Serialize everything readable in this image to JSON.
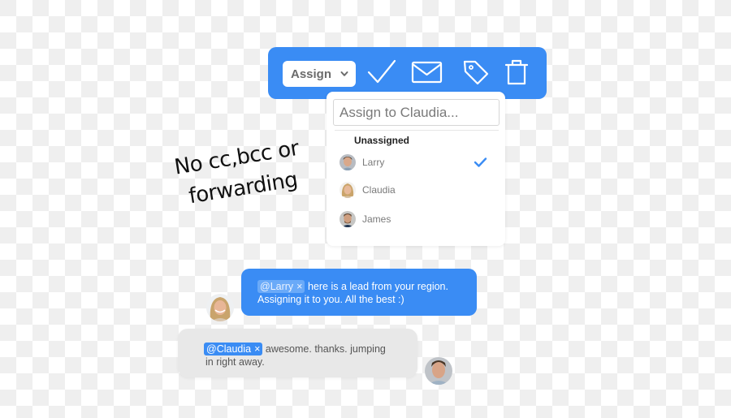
{
  "toolbar": {
    "assign_label": "Assign",
    "icons": [
      "checkmark-icon",
      "envelope-icon",
      "tag-icon",
      "trash-icon"
    ],
    "color": "#3a8cf4"
  },
  "dropdown": {
    "search_placeholder": "Assign to Claudia...",
    "section_label": "Unassigned",
    "items": [
      {
        "name": "Larry",
        "selected": true
      },
      {
        "name": "Claudia",
        "selected": false
      },
      {
        "name": "James",
        "selected": false
      }
    ]
  },
  "annotation": {
    "line1": "No cc,bcc or",
    "line2": "forwarding"
  },
  "messages": [
    {
      "sender": "Claudia",
      "mention": "@Larry",
      "mention_remove": "×",
      "text_line1": "here is a lead from your region.",
      "text_line2": "Assigning it to you. All the best :)"
    },
    {
      "sender": "Larry",
      "mention": "@Claudia",
      "mention_remove": "×",
      "text_line1": "awesome. thanks. jumping",
      "text_line2": "in right away."
    }
  ]
}
